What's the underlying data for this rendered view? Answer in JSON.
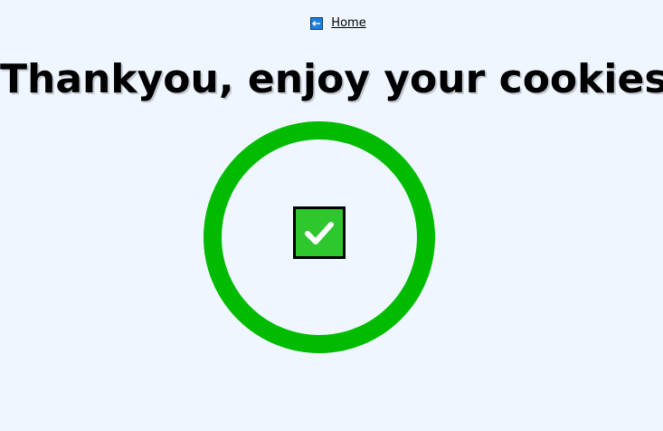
{
  "nav": {
    "home_label": "Home",
    "home_icon": "back-arrow-icon"
  },
  "main": {
    "title": "Thankyou, enjoy your cookies!",
    "status_icon": "checkmark-icon"
  },
  "colors": {
    "background": "#eff6ff",
    "ring": "#00bb00",
    "check_fill": "#2ec72e",
    "home_icon": "#1e7fd8"
  }
}
